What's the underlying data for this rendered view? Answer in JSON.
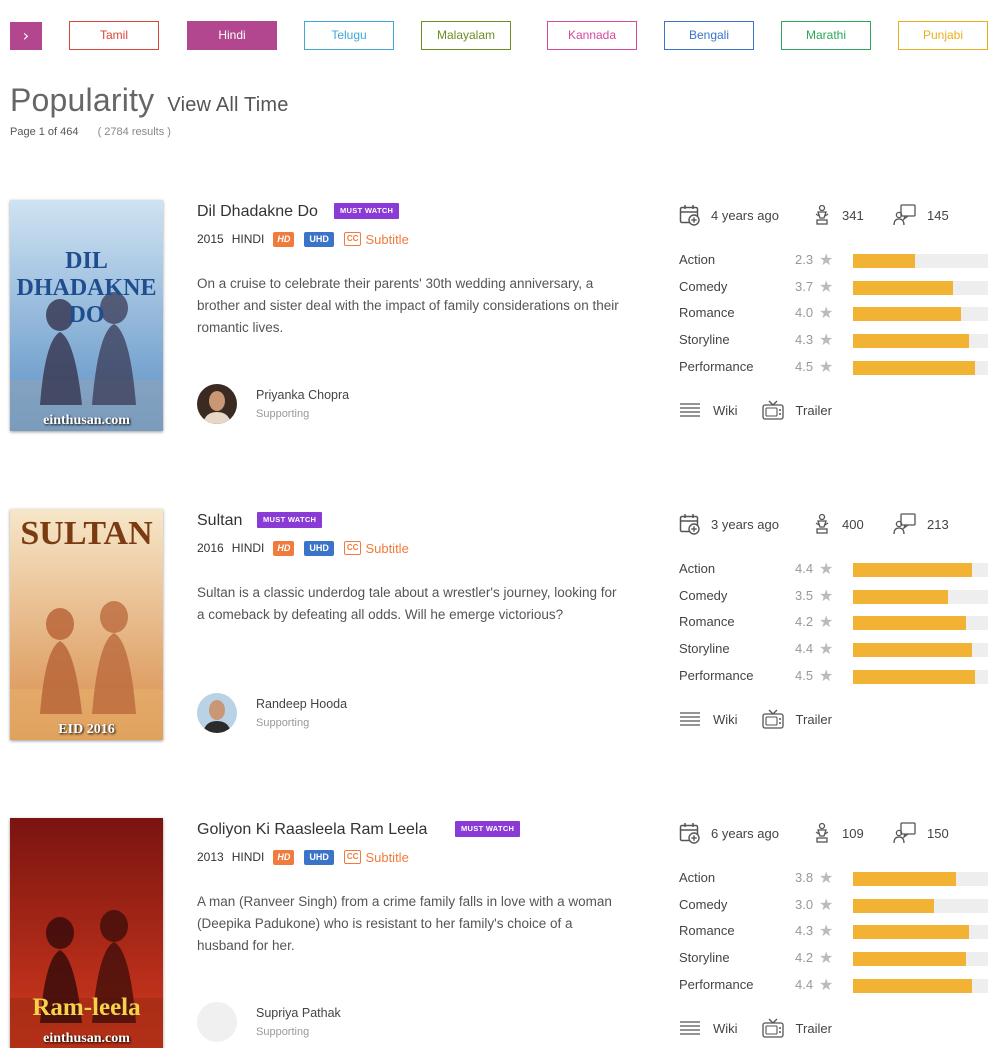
{
  "languages": [
    {
      "label": "Tamil",
      "color": "#d9473a",
      "active": false
    },
    {
      "label": "Hindi",
      "color": "#b3478f",
      "active": true
    },
    {
      "label": "Telugu",
      "color": "#3fa8d8",
      "active": false
    },
    {
      "label": "Malayalam",
      "color": "#6b8e23",
      "active": false
    },
    {
      "label": "Kannada",
      "color": "#d6479e",
      "active": false
    },
    {
      "label": "Bengali",
      "color": "#3b73c9",
      "active": false
    },
    {
      "label": "Marathi",
      "color": "#2ea65a",
      "active": false
    },
    {
      "label": "Punjabi",
      "color": "#e8b01e",
      "active": false
    }
  ],
  "header": {
    "title": "Popularity",
    "subtitle": "View All Time",
    "page_info": "Page 1 of 464",
    "results": "( 2784 results )"
  },
  "labels": {
    "must_watch": "MUST WATCH",
    "hd": "HD",
    "uhd": "UHD",
    "cc": "CC",
    "subtitle": "Subtitle",
    "wiki": "Wiki",
    "trailer": "Trailer",
    "arrow": "›"
  },
  "movies": [
    {
      "title": "Dil Dhadakne Do",
      "poster_title": "DIL DHADAKNE DO",
      "poster_site": "einthusan.com",
      "year": "2015",
      "language": "HINDI",
      "description": "On a cruise to celebrate their parents' 30th wedding anniversary, a brother and sister deal with the impact of family considerations on their romantic lives.",
      "actor": {
        "name": "Priyanka Chopra",
        "role": "Supporting"
      },
      "added": "4 years ago",
      "awards": "341",
      "reviews": "145",
      "ratings": [
        {
          "label": "Action",
          "value": 2.3
        },
        {
          "label": "Comedy",
          "value": 3.7
        },
        {
          "label": "Romance",
          "value": 4.0
        },
        {
          "label": "Storyline",
          "value": 4.3
        },
        {
          "label": "Performance",
          "value": 4.5
        }
      ]
    },
    {
      "title": "Sultan",
      "poster_title": "SULTAN",
      "poster_site": "EID 2016",
      "year": "2016",
      "language": "HINDI",
      "description": "Sultan is a classic underdog tale about a wrestler's journey, looking for a comeback by defeating all odds. Will he emerge victorious?",
      "actor": {
        "name": "Randeep Hooda",
        "role": "Supporting"
      },
      "added": "3 years ago",
      "awards": "400",
      "reviews": "213",
      "ratings": [
        {
          "label": "Action",
          "value": 4.4
        },
        {
          "label": "Comedy",
          "value": 3.5
        },
        {
          "label": "Romance",
          "value": 4.2
        },
        {
          "label": "Storyline",
          "value": 4.4
        },
        {
          "label": "Performance",
          "value": 4.5
        }
      ]
    },
    {
      "title": "Goliyon Ki Raasleela Ram Leela",
      "poster_title": "Ram-leela",
      "poster_site": "einthusan.com",
      "year": "2013",
      "language": "HINDI",
      "description": "A man (Ranveer Singh) from a crime family falls in love with a woman (Deepika Padukone) who is resistant to her family's choice of a husband for her.",
      "actor": {
        "name": "Supriya Pathak",
        "role": "Supporting"
      },
      "added": "6 years ago",
      "awards": "109",
      "reviews": "150",
      "ratings": [
        {
          "label": "Action",
          "value": 3.8
        },
        {
          "label": "Comedy",
          "value": 3.0
        },
        {
          "label": "Romance",
          "value": 4.3
        },
        {
          "label": "Storyline",
          "value": 4.2
        },
        {
          "label": "Performance",
          "value": 4.4
        }
      ]
    }
  ],
  "colors": {
    "accent": "#b3478f",
    "must_watch": "#8a3bd6",
    "hd": "#ef7b3c",
    "uhd": "#3b73c9",
    "rating_bar": "#f2b233"
  }
}
